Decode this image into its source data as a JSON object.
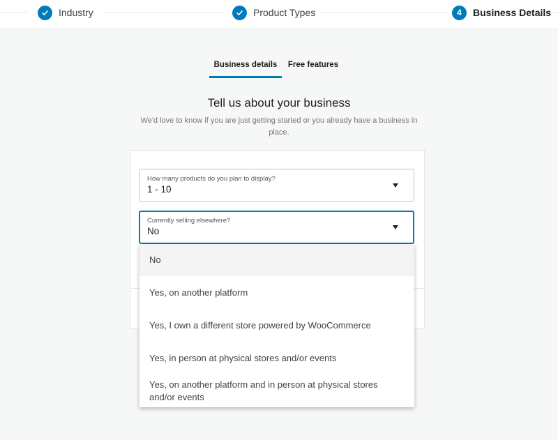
{
  "stepper": {
    "steps": [
      {
        "label": "Industry",
        "status": "complete",
        "icon": "check-icon"
      },
      {
        "label": "Product Types",
        "status": "complete",
        "icon": "check-icon"
      },
      {
        "label": "Business Details",
        "status": "active",
        "number": "4"
      }
    ]
  },
  "tabs": [
    {
      "label": "Business details",
      "active": true
    },
    {
      "label": "Free features",
      "active": false
    }
  ],
  "main": {
    "title": "Tell us about your business",
    "subtitle": "We'd love to know if you are just getting started or you already have a business in place."
  },
  "form": {
    "product_count": {
      "label": "How many products do you plan to display?",
      "value": "1 - 10"
    },
    "selling_elsewhere": {
      "label": "Currently selling elsewhere?",
      "value": "No",
      "open": true,
      "options": [
        "No",
        "Yes, on another platform",
        "Yes, I own a different store powered by WooCommerce",
        "Yes, in person at physical stores and/or events",
        "Yes, on another platform and in person at physical stores and/or events"
      ]
    }
  },
  "colors": {
    "accent": "#007cba",
    "background": "#f6f7f7",
    "text": "#1e1e1e",
    "muted": "#757575"
  }
}
